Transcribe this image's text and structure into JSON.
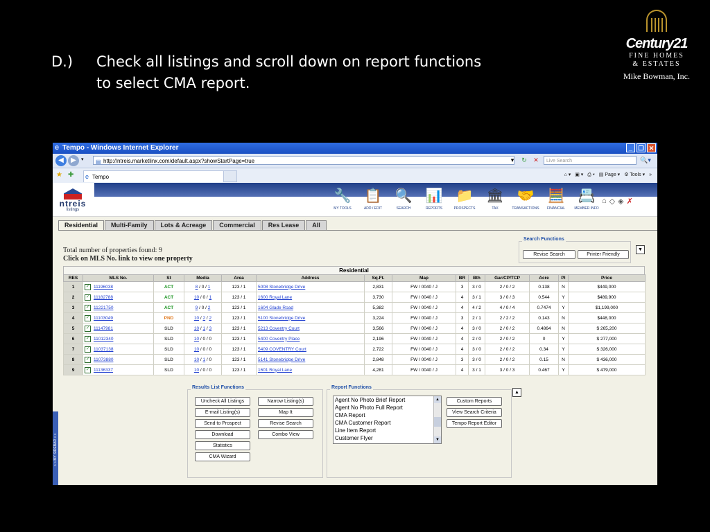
{
  "slide": {
    "prefix": "D.)",
    "line1": "Check all listings and scroll down on report functions",
    "line2": "to select CMA report.",
    "logo_brand": "Century21",
    "logo_sub1": "FINE HOMES",
    "logo_sub2": "& ESTATES",
    "logo_owner": "Mike Bowman, Inc."
  },
  "browser": {
    "title": "Tempo - Windows Internet Explorer",
    "url": "http://ntreis.marketlinx.com/default.aspx?showStartPage=true",
    "search_placeholder": "Live Search",
    "tab_label": "Tempo",
    "page_label": "Page",
    "tools_label": "Tools"
  },
  "app": {
    "logo_name": "ntreis",
    "logo_tag": "listings",
    "tools": [
      {
        "label": "MY TOOLS",
        "icon": "tools-icon",
        "glyph": "🔧"
      },
      {
        "label": "ADD / EDIT",
        "icon": "add-edit-icon",
        "glyph": "📋"
      },
      {
        "label": "SEARCH",
        "icon": "search-icon",
        "glyph": "🔍"
      },
      {
        "label": "REPORTS",
        "icon": "reports-icon",
        "glyph": "📊"
      },
      {
        "label": "PROSPECTS",
        "icon": "prospects-icon",
        "glyph": "📁"
      },
      {
        "label": "TAX",
        "icon": "tax-icon",
        "glyph": "🏛"
      },
      {
        "label": "TRANSACTIONS",
        "icon": "transactions-icon",
        "glyph": "🤝"
      },
      {
        "label": "FINANCIAL",
        "icon": "calculator-icon",
        "glyph": "🧮"
      },
      {
        "label": "MEMBER INFO",
        "icon": "member-info-icon",
        "glyph": "📇"
      }
    ],
    "tabs": [
      "Residential",
      "Multi-Family",
      "Lots & Acreage",
      "Commercial",
      "Res Lease",
      "All"
    ],
    "count_text": "Total number of properties found: 9",
    "click_text": "Click on MLS No. link to view one property",
    "search_functions": {
      "title": "Search Functions",
      "revise": "Revise Search",
      "printer": "Printer Friendly"
    },
    "sidebar_label": "» » MY SIDEBAR » »"
  },
  "table": {
    "caption": "Residential",
    "headers": [
      "RES",
      "MLS No.",
      "St",
      "Media",
      "Area",
      "Address",
      "Sq.Ft.",
      "Map",
      "BR",
      "Bth",
      "Gar/CP/TCP",
      "Acre",
      "Pl",
      "Price"
    ],
    "rows": [
      {
        "n": "1",
        "mls": "11196038",
        "st": "ACT",
        "media": [
          "8",
          "0",
          "1"
        ],
        "area": "123 / 1",
        "address": "5008 Stonebridge Drive",
        "sqft": "2,831",
        "map": "FW / 0040 / J",
        "br": "3",
        "bth": "3 / 0",
        "gar": "2 / 0 / 2",
        "acre": "0.138",
        "pl": "N",
        "price": "$449,000"
      },
      {
        "n": "2",
        "mls": "11182788",
        "st": "ACT",
        "media": [
          "10",
          "0",
          "1"
        ],
        "area": "123 / 1",
        "address": "1600 Royal Lane",
        "sqft": "3,730",
        "map": "FW / 0040 / J",
        "br": "4",
        "bth": "3 / 1",
        "gar": "3 / 0 / 3",
        "acre": "0.544",
        "pl": "Y",
        "price": "$489,900"
      },
      {
        "n": "3",
        "mls": "11221750",
        "st": "ACT",
        "media": [
          "9",
          "0",
          "2"
        ],
        "area": "123 / 1",
        "address": "1604 Glade Road",
        "sqft": "5,382",
        "map": "FW / 0040 / J",
        "br": "4",
        "bth": "4 / 2",
        "gar": "4 / 0 / 4",
        "acre": "0.7474",
        "pl": "Y",
        "price": "$1,199,000"
      },
      {
        "n": "4",
        "mls": "11103049",
        "st": "PND",
        "media": [
          "10",
          "2",
          "2"
        ],
        "area": "123 / 1",
        "address": "5100 Stonebridge Drive",
        "sqft": "3,224",
        "map": "FW / 0040 / J",
        "br": "3",
        "bth": "2 / 1",
        "gar": "2 / 2 / 2",
        "acre": "0.143",
        "pl": "N",
        "price": "$448,000"
      },
      {
        "n": "5",
        "mls": "11147981",
        "st": "SLD",
        "media": [
          "10",
          "1",
          "3"
        ],
        "area": "123 / 1",
        "address": "5213 Coventry Court",
        "sqft": "3,566",
        "map": "FW / 0040 / J",
        "br": "4",
        "bth": "3 / 0",
        "gar": "2 / 0 / 2",
        "acre": "0.4864",
        "pl": "N",
        "price": "$ 265,200"
      },
      {
        "n": "6",
        "mls": "11012340",
        "st": "SLD",
        "media": [
          "10",
          "0",
          "0"
        ],
        "area": "123 / 1",
        "address": "5400 Coventry Place",
        "sqft": "2,196",
        "map": "FW / 0040 / J",
        "br": "4",
        "bth": "2 / 0",
        "gar": "2 / 0 / 2",
        "acre": "0",
        "pl": "Y",
        "price": "$ 277,000"
      },
      {
        "n": "7",
        "mls": "11037138",
        "st": "SLD",
        "media": [
          "10",
          "0",
          "0"
        ],
        "area": "123 / 1",
        "address": "5409 COVENTRY Court",
        "sqft": "2,722",
        "map": "FW / 0040 / J",
        "br": "4",
        "bth": "3 / 0",
        "gar": "2 / 0 / 2",
        "acre": "0.34",
        "pl": "Y",
        "price": "$ 326,000"
      },
      {
        "n": "8",
        "mls": "11073880",
        "st": "SLD",
        "media": [
          "10",
          "1",
          "0"
        ],
        "area": "123 / 1",
        "address": "5141 Stonebridge Drive",
        "sqft": "2,848",
        "map": "FW / 0040 / J",
        "br": "3",
        "bth": "3 / 0",
        "gar": "2 / 0 / 2",
        "acre": "0.15",
        "pl": "N",
        "price": "$ 436,000"
      },
      {
        "n": "9",
        "mls": "11136337",
        "st": "SLD",
        "media": [
          "10",
          "0",
          "0"
        ],
        "area": "123 / 1",
        "address": "1601 Royal Lane",
        "sqft": "4,281",
        "map": "FW / 0040 / J",
        "br": "4",
        "bth": "3 / 1",
        "gar": "3 / 0 / 3",
        "acre": "0.467",
        "pl": "Y",
        "price": "$ 479,000"
      }
    ]
  },
  "results_functions": {
    "title": "Results List Functions",
    "buttons": [
      "Uncheck All Listings",
      "E-mail Listing(s)",
      "Send to Prospect",
      "Download",
      "Statistics",
      "CMA Wizard",
      "Narrow Listing(s)",
      "Map It",
      "Revise Search",
      "Combo View"
    ]
  },
  "report_functions": {
    "title": "Report Functions",
    "options": [
      "Agent No Photo Brief Report",
      "Agent No Photo Full Report",
      "CMA Report",
      "CMA Customer Report",
      "Line Item Report",
      "Customer Flyer"
    ],
    "buttons": [
      "Custom Reports",
      "View Search Criteria",
      "Tempo Report Editor"
    ]
  },
  "colors": {
    "act": "#18931e",
    "pnd": "#e0781a",
    "sld": "#555555",
    "link": "#1f3fd0",
    "titlebar": "#2f6de2"
  }
}
